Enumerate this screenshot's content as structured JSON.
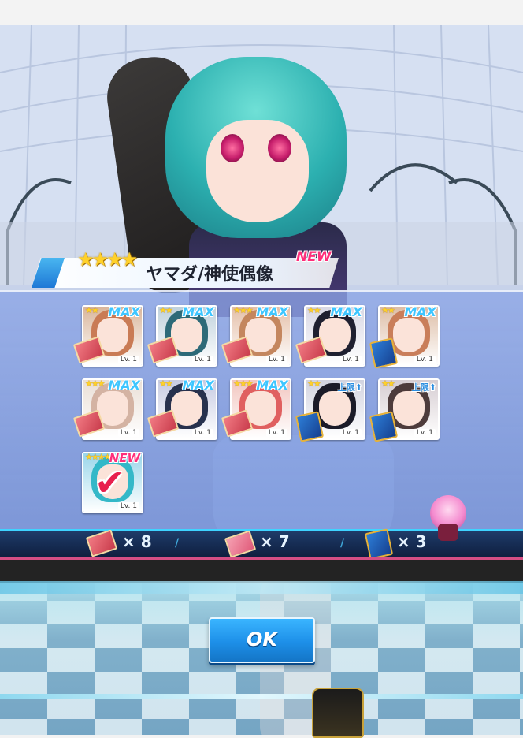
{
  "banner": {
    "stars": "★★★★",
    "name": "ヤマダ/神使偶像",
    "new_label": "NEW"
  },
  "cards": [
    {
      "stars": "★★",
      "tag": "MAX",
      "level": "Lv. 1",
      "bg": "#d9b59b",
      "hair": "#c97b55",
      "item": "book"
    },
    {
      "stars": "★★",
      "tag": "MAX",
      "level": "Lv. 1",
      "bg": "#bfd1dc",
      "hair": "#2d6a78",
      "item": "book"
    },
    {
      "stars": "★★★",
      "tag": "MAX",
      "level": "Lv. 1",
      "bg": "#e4bfa8",
      "hair": "#c4865e",
      "item": "book"
    },
    {
      "stars": "★★",
      "tag": "MAX",
      "level": "Lv. 1",
      "bg": "#d8d8e4",
      "hair": "#1f2030",
      "item": "book"
    },
    {
      "stars": "★★",
      "tag": "MAX",
      "level": "Lv. 1",
      "bg": "#ddbda6",
      "hair": "#c97e5a",
      "item": "blue"
    },
    {
      "stars": "★★★",
      "tag": "MAX",
      "level": "Lv. 1",
      "bg": "#eadfd6",
      "hair": "#d4b3a3",
      "item": "book"
    },
    {
      "stars": "★★",
      "tag": "MAX",
      "level": "Lv. 1",
      "bg": "#c7cbe2",
      "hair": "#27314d",
      "item": "book"
    },
    {
      "stars": "★★★",
      "tag": "MAX",
      "level": "Lv. 1",
      "bg": "#f2c6c0",
      "hair": "#e06060",
      "item": "book"
    },
    {
      "stars": "★★",
      "tag": "上限⬆",
      "level": "Lv. 1",
      "bg": "#d2d4e0",
      "hair": "#1b1b28",
      "item": "blue"
    },
    {
      "stars": "★★",
      "tag": "上限⬆",
      "level": "Lv. 1",
      "bg": "#d6cdd2",
      "hair": "#4d3b3b",
      "item": "blue"
    },
    {
      "stars": "★★★★",
      "tag": "NEW",
      "level": "Lv. 1",
      "bg": "#9ad6ea",
      "hair": "#34b8c8",
      "item": "check"
    }
  ],
  "summary": {
    "book_count": "× 8",
    "ticket_count": "× 7",
    "card_count": "× 3"
  },
  "ok_button": {
    "label": "OK"
  }
}
